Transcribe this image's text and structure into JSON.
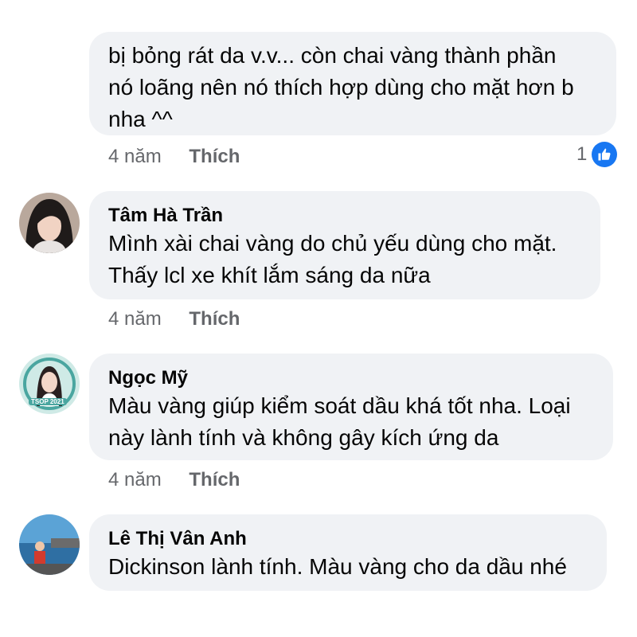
{
  "colors": {
    "bubble": "#f0f2f5",
    "meta": "#65676b",
    "like_blue": "#1877f2"
  },
  "comments": [
    {
      "text": "bị bỏng rát da v.v... còn chai vàng thành phần\nnó loãng nên nó thích hợp dùng cho mặt hơn b\nnha ^^",
      "time": "4 năm",
      "like_label": "Thích",
      "reaction_count": "1",
      "reaction_icon": "thumbs-up-icon"
    },
    {
      "author": "Tâm Hà Trần",
      "text": "Mình xài chai vàng do chủ yếu dùng cho mặt.\nThấy lcl xe khít lắm sáng da nữa",
      "time": "4 năm",
      "like_label": "Thích"
    },
    {
      "author": "Ngọc Mỹ",
      "text": "Màu vàng giúp kiểm soát dầu khá tốt nha. Loại\nnày lành tính và không gây kích ứng da",
      "time": "4 năm",
      "like_label": "Thích",
      "avatar_badge": "TSOP 2021"
    },
    {
      "author": "Lê Thị Vân Anh",
      "text": "Dickinson lành tính. Màu vàng cho da dầu nhé"
    }
  ]
}
